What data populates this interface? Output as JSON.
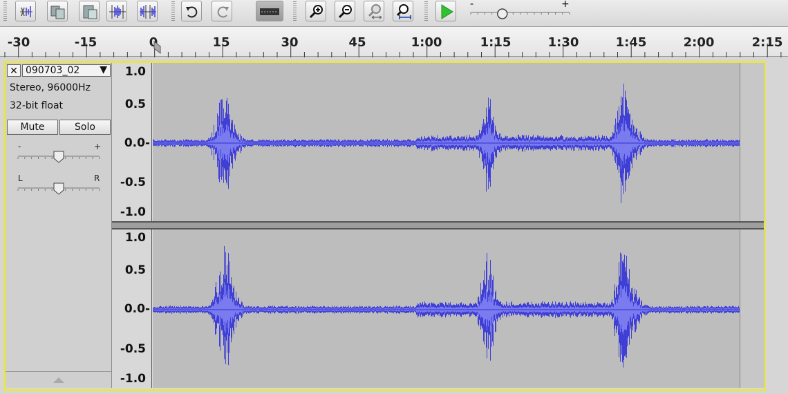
{
  "toolbar": {
    "buttons": [
      {
        "name": "trim-icon"
      },
      {
        "name": "silence-icon"
      },
      {
        "name": "paste-icon"
      },
      {
        "name": "trim-audio-icon"
      },
      {
        "name": "silence-audio-icon"
      },
      {
        "name": "undo-icon"
      },
      {
        "name": "redo-icon"
      },
      {
        "name": "sync-lock-icon"
      },
      {
        "name": "zoom-in-icon"
      },
      {
        "name": "zoom-out-icon"
      },
      {
        "name": "fit-selection-icon"
      },
      {
        "name": "fit-project-icon"
      },
      {
        "name": "play-at-speed-icon"
      }
    ],
    "slider_minus": "-",
    "slider_plus": "+",
    "play_speed_level": 0.32
  },
  "ruler": {
    "labels": [
      "-30",
      "-15",
      "0",
      "15",
      "30",
      "45",
      "1:00",
      "1:15",
      "1:30",
      "1:45",
      "2:00",
      "2:15"
    ],
    "cursor_label": "0"
  },
  "track": {
    "name": "090703_02",
    "info_line1": "Stereo, 96000Hz",
    "info_line2": "32-bit float",
    "mute_label": "Mute",
    "solo_label": "Solo",
    "gain_minus": "-",
    "gain_plus": "+",
    "pan_left": "L",
    "pan_right": "R",
    "gain_level": 0.5,
    "pan_level": 0.5
  },
  "scale": {
    "top_channel": [
      "1.0",
      "0.5",
      "0.0-",
      "-0.5",
      "-1.0"
    ],
    "bottom_channel": [
      "1.0",
      "0.5",
      "0.0-",
      "-0.5",
      "-1.0"
    ]
  },
  "colors": {
    "wave": "#3f3fd6",
    "wave_rms": "#7b7bf0",
    "wave_bg": "#bdbdbd",
    "track_frame": "#e9e54a",
    "play_green": "#2fc32f"
  }
}
